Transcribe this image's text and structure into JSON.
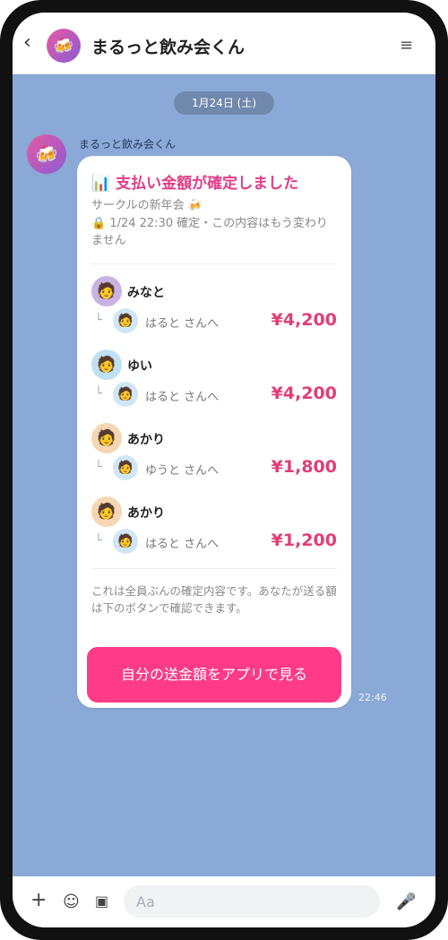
{
  "header": {
    "back_icon": "chevron-left-icon",
    "back_glyph": "‹",
    "avatar_glyph": "🍻",
    "title": "まるっと飲み会くん",
    "menu_glyph": "≡"
  },
  "chat": {
    "date": "1月24日 (土)",
    "sender_name": "まるっと飲み会くん",
    "bot_avatar_glyph": "🍻",
    "time": "22:46"
  },
  "card": {
    "title_icon": "📊",
    "title": "支払い金額が確定しました",
    "subtitle": "サークルの新年会 🍻",
    "lock_text": "🔒 1/24 22:30 確定・この内容はもう変わりません",
    "payments": [
      {
        "payer": "みなと",
        "payee": "はるとさんへ",
        "payee_display": "はると さんへ",
        "amount": "¥4,200",
        "payer_glyph": "🧑",
        "payer_bg": "#c9b3e3",
        "payee_glyph": "🧑"
      },
      {
        "payer": "ゆい",
        "payee": "はるとさんへ",
        "payee_display": "はると さんへ",
        "amount": "¥4,200",
        "payer_glyph": "🧑",
        "payer_bg": "#bfe1f3",
        "payee_glyph": "🧑"
      },
      {
        "payer": "あかり",
        "payee": "ゆうとさんへ",
        "payee_display": "ゆうと さんへ",
        "amount": "¥1,800",
        "payer_glyph": "🧑",
        "payer_bg": "#f7d6b3",
        "payee_glyph": "🧑"
      },
      {
        "payer": "あかり",
        "payee": "はるとさんへ",
        "payee_display": "はると さんへ",
        "amount": "¥1,200",
        "payer_glyph": "🧑",
        "payer_bg": "#f7d6b3",
        "payee_glyph": "🧑"
      }
    ],
    "note": "これは全員ぶんの確定内容です。あなたが送る額は下のボタンで確認できます。",
    "cta": "自分の送金額をアプリで見る"
  },
  "input_bar": {
    "plus_glyph": "+",
    "smile_glyph": "☺",
    "image_glyph": "▣",
    "placeholder": "Aa",
    "mic_glyph": "🎤"
  },
  "colors": {
    "chat_bg": "#8aa9d6",
    "accent": "#e23d86",
    "cta_bg": "#ff3a86"
  }
}
